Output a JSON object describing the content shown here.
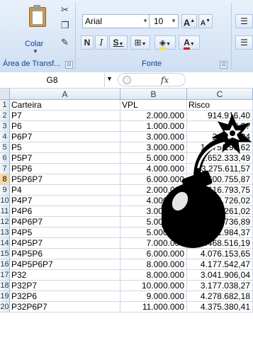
{
  "ribbon": {
    "paste_label": "Colar",
    "clipboard_group": "Área de Transf...",
    "font_group": "Fonte",
    "font_name": "Arial",
    "font_size": "10",
    "grow_font": "A",
    "shrink_font": "A",
    "bold": "N",
    "italic": "I",
    "underline": "S",
    "font_color_letter": "A",
    "launcher": "⊡"
  },
  "formula_bar": {
    "name_box": "G8",
    "fx": "fx"
  },
  "columns": [
    "A",
    "B",
    "C"
  ],
  "selected_row": "8",
  "rows": [
    {
      "n": "1",
      "a": "Carteira",
      "b": "VPL",
      "c": "Risco",
      "header": true
    },
    {
      "n": "2",
      "a": "P7",
      "b": "2.000.000",
      "c": "914.916,40"
    },
    {
      "n": "3",
      "a": "P6",
      "b": "1.000.000",
      "c": "2.??"
    },
    {
      "n": "4",
      "a": "P6P7",
      "b": "3.000.000",
      "c": "2.420.??4"
    },
    {
      "n": "5",
      "a": "P5",
      "b": "3.000.000",
      "c": "1.375.190,62"
    },
    {
      "n": "6",
      "a": "P5P7",
      "b": "5.000.000",
      "c": "1.652.333,49"
    },
    {
      "n": "7",
      "a": "P5P6",
      "b": "4.000.000",
      "c": "3.275.611,57"
    },
    {
      "n": "8",
      "a": "P5P6P7",
      "b": "6.000.000",
      "c": "3.600.755,87"
    },
    {
      "n": "9",
      "a": "P4",
      "b": "2.000.000",
      "c": "3.616.793,75"
    },
    {
      "n": "10",
      "a": "P4P7",
      "b": "4.000.000",
      "c": "2.595.726,02"
    },
    {
      "n": "11",
      "a": "P4P6",
      "b": "3.000.000",
      "c": "2.901.261,02"
    },
    {
      "n": "12",
      "a": "P4P6P7",
      "b": "5.000.000",
      "c": "3.041.736,89"
    },
    {
      "n": "13",
      "a": "P4P5",
      "b": "5.000.000",
      "c": "2.291.984,37"
    },
    {
      "n": "14",
      "a": "P4P5P7",
      "b": "7.000.000",
      "c": "2.468.516,19"
    },
    {
      "n": "15",
      "a": "P4P5P6",
      "b": "6.000.000",
      "c": "4.076.153,65"
    },
    {
      "n": "16",
      "a": "P4P5P6P7",
      "b": "8.000.000",
      "c": "4.177.542,47"
    },
    {
      "n": "17",
      "a": "P32",
      "b": "8.000.000",
      "c": "3.041.906,04"
    },
    {
      "n": "18",
      "a": "P32P7",
      "b": "10.000.000",
      "c": "3.177.038,27"
    },
    {
      "n": "19",
      "a": "P32P6",
      "b": "9.000.000",
      "c": "4.278.682,18"
    },
    {
      "n": "20",
      "a": "P32P6P7",
      "b": "11.000.000",
      "c": "4.375.380,41"
    }
  ],
  "colors": {
    "ribbon_top": "#e9f1fb",
    "ribbon_bottom": "#cfdff3",
    "group_label": "#15428b",
    "selected_row_header": "#f9d99f",
    "bomb": "#000000"
  }
}
